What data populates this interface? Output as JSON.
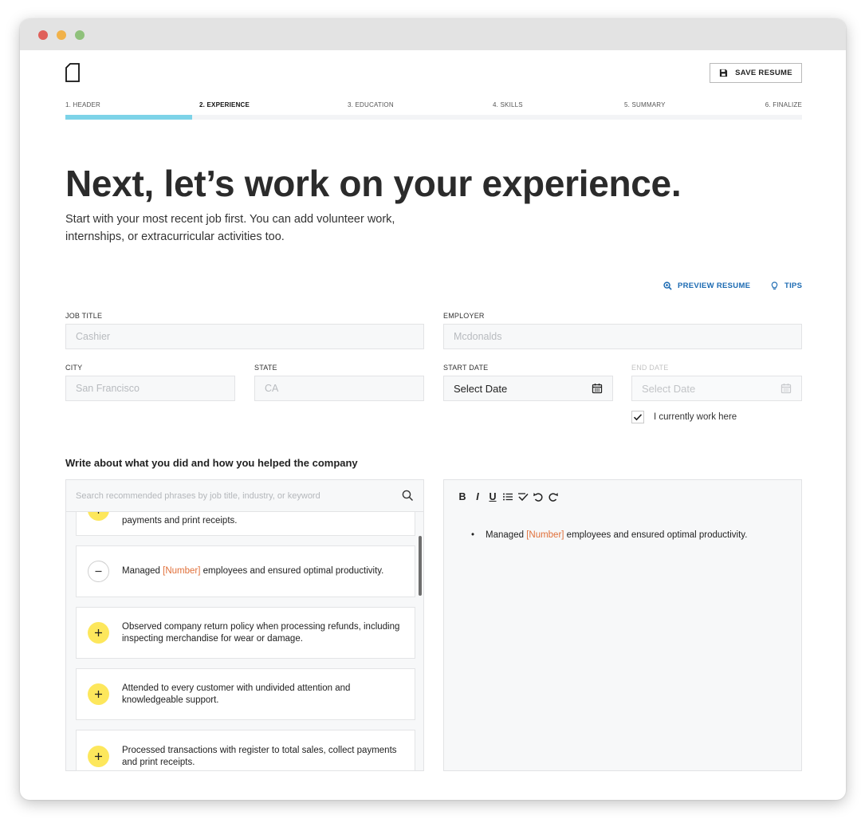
{
  "header": {
    "save_label": "SAVE RESUME"
  },
  "steps": [
    {
      "label": "1. HEADER"
    },
    {
      "label": "2. EXPERIENCE"
    },
    {
      "label": "3. EDUCATION"
    },
    {
      "label": "4. SKILLS"
    },
    {
      "label": "5. SUMMARY"
    },
    {
      "label": "6. FINALIZE"
    }
  ],
  "progress": {
    "current_step": 2,
    "total_steps": 6
  },
  "page": {
    "headline": "Next, let’s work on your experience.",
    "subline": "Start with your most recent job first. You can add volunteer work, internships, or extracurricular activities too."
  },
  "links": {
    "preview": "PREVIEW RESUME",
    "tips": "TIPS"
  },
  "form": {
    "job_title": {
      "label": "JOB TITLE",
      "placeholder": "Cashier"
    },
    "employer": {
      "label": "EMPLOYER",
      "placeholder": "Mcdonalds"
    },
    "city": {
      "label": "CITY",
      "placeholder": "San Francisco"
    },
    "state": {
      "label": "STATE",
      "placeholder": "CA"
    },
    "start_date": {
      "label": "START DATE",
      "value": "Select Date"
    },
    "end_date": {
      "label": "END DATE",
      "value": "Select Date"
    },
    "current": {
      "label": "I currently work here",
      "checked": true
    }
  },
  "section": {
    "title": "Write about what you did and how you helped the company"
  },
  "search": {
    "placeholder": "Search recommended phrases by job title, industry, or keyword"
  },
  "phrases": [
    {
      "text_before": "payments and print receipts.",
      "placeholder": "",
      "text_after": "",
      "state": "add"
    },
    {
      "text_before": "Managed ",
      "placeholder": "[Number]",
      "text_after": " employees and ensured optimal productivity.",
      "state": "remove"
    },
    {
      "text_before": "Observed company return policy when processing refunds, including inspecting merchandise for wear or damage.",
      "placeholder": "",
      "text_after": "",
      "state": "add"
    },
    {
      "text_before": "Attended to every customer with undivided attention and knowledgeable support.",
      "placeholder": "",
      "text_after": "",
      "state": "add"
    },
    {
      "text_before": "Processed transactions with register to total sales, collect payments and print receipts.",
      "placeholder": "",
      "text_after": "",
      "state": "add"
    }
  ],
  "editor": {
    "toolbar": {
      "bold": "B",
      "italic": "I",
      "underline": "U"
    },
    "bullets": [
      {
        "before": "Managed ",
        "placeholder": "[Number]",
        "after": " employees and ensured optimal productivity."
      }
    ]
  },
  "colors": {
    "progress": "#7dd3e8",
    "link": "#1b6ab2",
    "add_circle": "#fde75c",
    "placeholder_token": "#e0703a"
  }
}
